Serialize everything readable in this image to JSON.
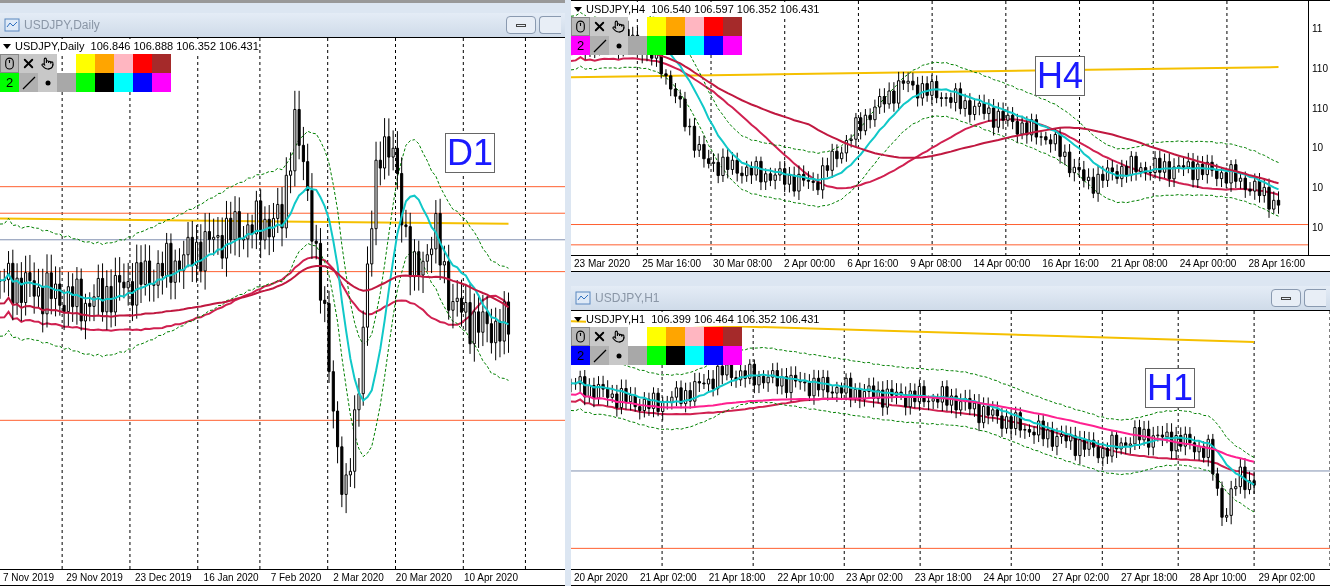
{
  "windows": [
    {
      "kind": "daily",
      "title": "USDJPY,Daily",
      "symbol_line": "USDJPY,Daily  106.846 106.888 106.352 106.431",
      "timeframe_label": "D1",
      "toolbar": {
        "number": "2",
        "color": "#00ff00"
      },
      "palette": [
        {
          "color": "#ffff00"
        },
        {
          "color": "#ffa500"
        },
        {
          "color": "#ffb6c1"
        },
        {
          "color": "#ff0000"
        },
        {
          "color": "#a52a2a"
        },
        {
          "color": "#00ff00"
        },
        {
          "color": "#000000"
        },
        {
          "color": "#00ffff"
        },
        {
          "color": "#0000ff"
        },
        {
          "color": "#ff00ff"
        }
      ],
      "time_labels": [
        "7 Nov 2019",
        "29 Nov 2019",
        "23 Dec 2019",
        "16 Jan 2020",
        "7 Feb 2020",
        "2 Mar 2020",
        "20 Mar 2020",
        "10 Apr 2020"
      ]
    },
    {
      "kind": "h4",
      "symbol_line": "USDJPY,H4  106.540 106.597 106.352 106.431",
      "timeframe_label": "H4",
      "toolbar": {
        "number": "2",
        "color": "#ff00ff"
      },
      "palette": [
        {
          "color": "#ffff00"
        },
        {
          "color": "#ffa500"
        },
        {
          "color": "#ffb6c1"
        },
        {
          "color": "#ff0000"
        },
        {
          "color": "#a52a2a"
        },
        {
          "color": "#00ff00"
        },
        {
          "color": "#000000"
        },
        {
          "color": "#00ffff"
        },
        {
          "color": "#0000ff"
        },
        {
          "color": "#ff00ff"
        }
      ],
      "price_labels": [
        "11",
        "110",
        "110",
        "10",
        "10",
        "10"
      ],
      "time_labels": [
        "23 Mar 2020",
        "25 Mar 16:00",
        "30 Mar 08:00",
        "2 Apr 00:00",
        "6 Apr 16:00",
        "9 Apr 08:00",
        "14 Apr 00:00",
        "16 Apr 16:00",
        "21 Apr 08:00",
        "24 Apr 00:00",
        "28 Apr 16:00"
      ]
    },
    {
      "kind": "h1",
      "title": "USDJPY,H1",
      "symbol_line": "USDJPY,H1  106.399 106.464 106.352 106.431",
      "timeframe_label": "H1",
      "toolbar": {
        "number": "2",
        "color": "#0000ff"
      },
      "palette": [
        {
          "color": "#ffff00"
        },
        {
          "color": "#ffa500"
        },
        {
          "color": "#ffb6c1"
        },
        {
          "color": "#ff0000"
        },
        {
          "color": "#a52a2a"
        },
        {
          "color": "#00ff00"
        },
        {
          "color": "#000000"
        },
        {
          "color": "#00ffff"
        },
        {
          "color": "#0000ff"
        },
        {
          "color": "#ff00ff"
        }
      ],
      "time_labels": [
        "20 Apr 2020",
        "21 Apr 02:00",
        "21 Apr 18:00",
        "22 Apr 10:00",
        "23 Apr 02:00",
        "23 Apr 18:00",
        "24 Apr 10:00",
        "27 Apr 02:00",
        "27 Apr 18:00",
        "28 Apr 10:00",
        "29 Apr 02:00"
      ]
    }
  ]
}
